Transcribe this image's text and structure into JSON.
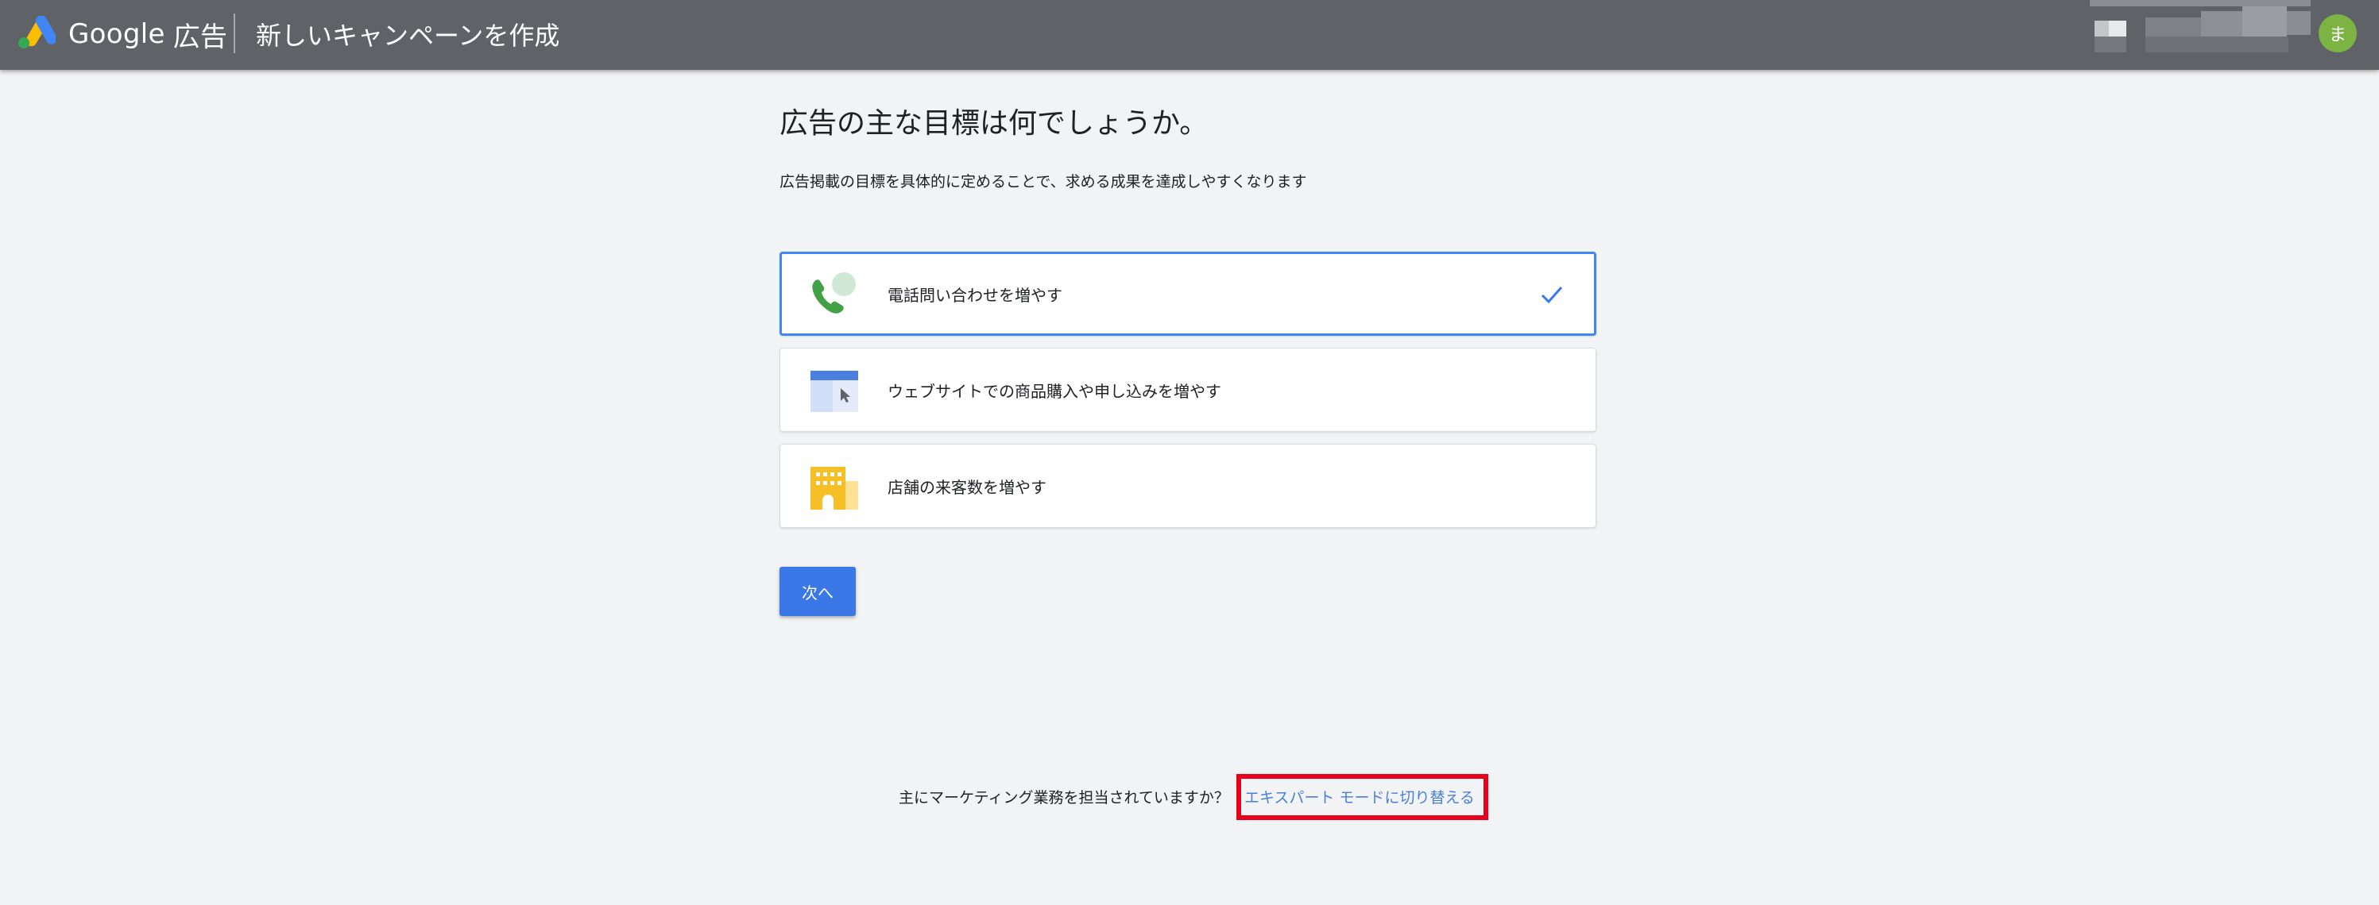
{
  "header": {
    "brand_google": "Google",
    "brand_ads": "広告",
    "title": "新しいキャンペーンを作成",
    "avatar_initial": "ま"
  },
  "main": {
    "heading": "広告の主な目標は何でしょうか。",
    "subheading": "広告掲載の目標を具体的に定めることで、求める成果を達成しやすくなります",
    "goals": [
      {
        "label": "電話問い合わせを増やす",
        "icon": "phone-call-icon",
        "selected": true
      },
      {
        "label": "ウェブサイトでの商品購入や申し込みを増やす",
        "icon": "website-icon",
        "selected": false
      },
      {
        "label": "店舗の来客数を増やす",
        "icon": "storefront-icon",
        "selected": false
      }
    ],
    "next_label": "次へ"
  },
  "footer": {
    "question": "主にマーケティング業務を担当されていますか？",
    "expert_link": "エキスパート モードに切り替える"
  },
  "colors": {
    "header_bg": "#5f6368",
    "page_bg": "#f1f3f4",
    "primary_button": "#3b78e7",
    "selected_border": "#4285f4",
    "link": "#4a7fd9",
    "highlight": "#e8001c",
    "avatar": "#7cb342"
  }
}
